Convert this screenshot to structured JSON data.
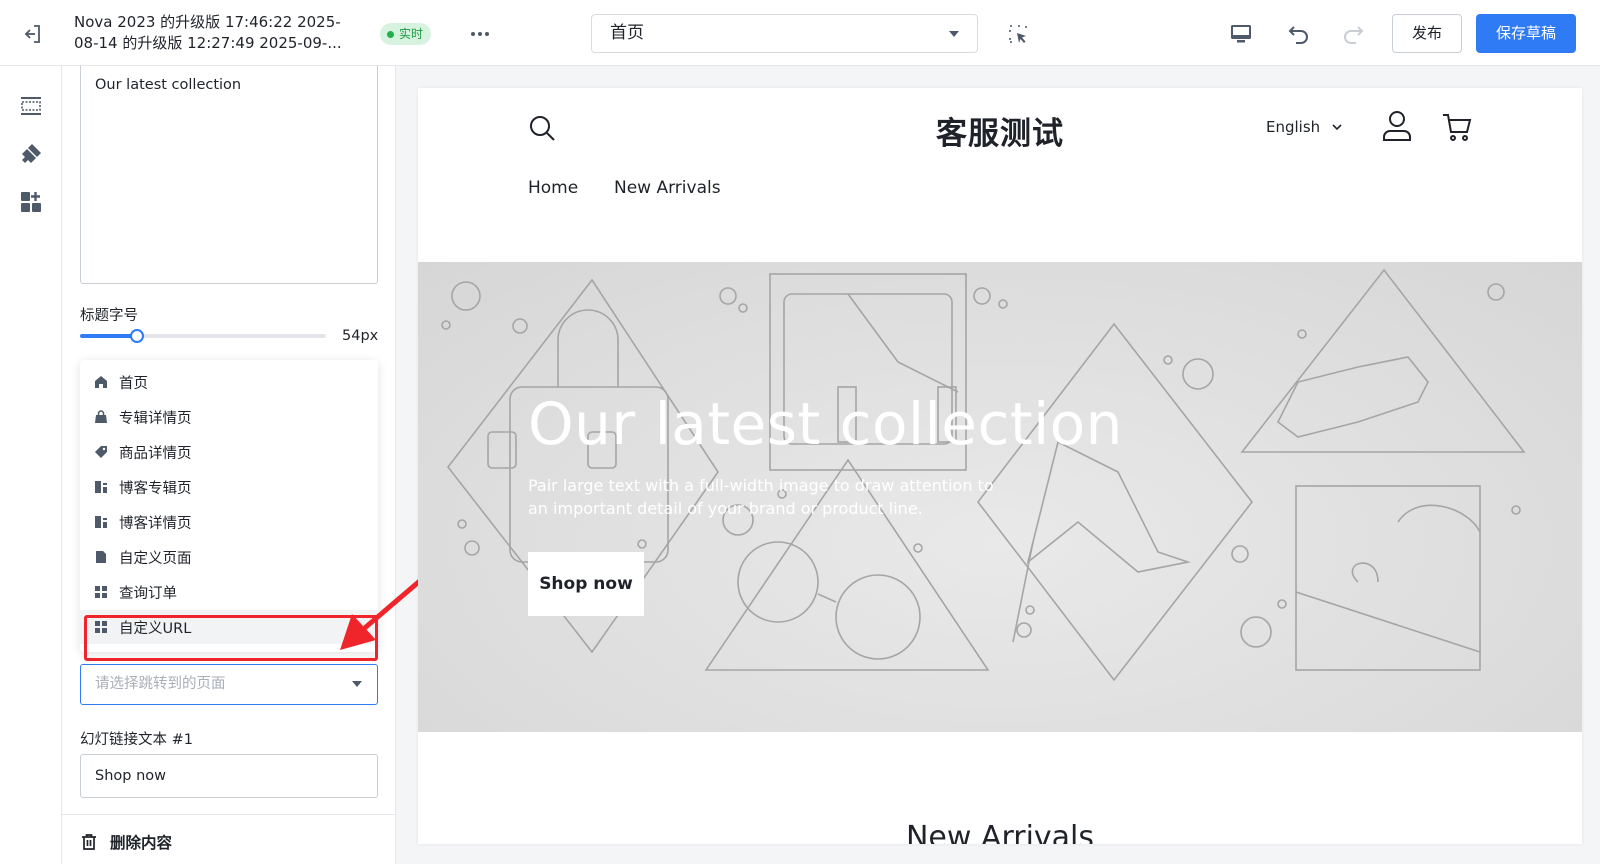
{
  "topbar": {
    "theme_line1": "Nova 2023 的升级版 17:46:22 2025-",
    "theme_line2": "08-14 的升级版 12:27:49 2025-09-...",
    "live_badge": "实时",
    "page_selected": "首页",
    "publish_label": "发布",
    "save_label": "保存草稿"
  },
  "panel": {
    "textarea_value": "Our latest collection",
    "size_label": "标题字号",
    "size_value": "54px",
    "slider_level_percent": 23,
    "dropdown_items": [
      {
        "label": "首页",
        "icon": "home-icon"
      },
      {
        "label": "专辑详情页",
        "icon": "bag-icon"
      },
      {
        "label": "商品详情页",
        "icon": "tag-icon"
      },
      {
        "label": "博客专辑页",
        "icon": "blog-icon"
      },
      {
        "label": "博客详情页",
        "icon": "blog-icon"
      },
      {
        "label": "自定义页面",
        "icon": "file-icon"
      },
      {
        "label": "查询订单",
        "icon": "grid-icon"
      },
      {
        "label": "自定义URL",
        "icon": "grid-icon"
      }
    ],
    "link_select_placeholder": "请选择跳转到的页面",
    "link_text_label": "幻灯链接文本 #1",
    "link_text_value": "Shop now",
    "delete_label": "删除内容"
  },
  "preview": {
    "brand": "客服测试",
    "language": "English",
    "nav": [
      "Home",
      "New Arrivals"
    ],
    "hero_title": "Our latest collection",
    "hero_subtitle": "Pair large text with a full-width image to draw attention to an important detail of your brand or product line.",
    "hero_button": "Shop now",
    "section_title": "New Arrivals"
  },
  "colors": {
    "primary": "#2f7bf5",
    "live_green": "#22b04a",
    "highlight_red": "#f0252b"
  }
}
